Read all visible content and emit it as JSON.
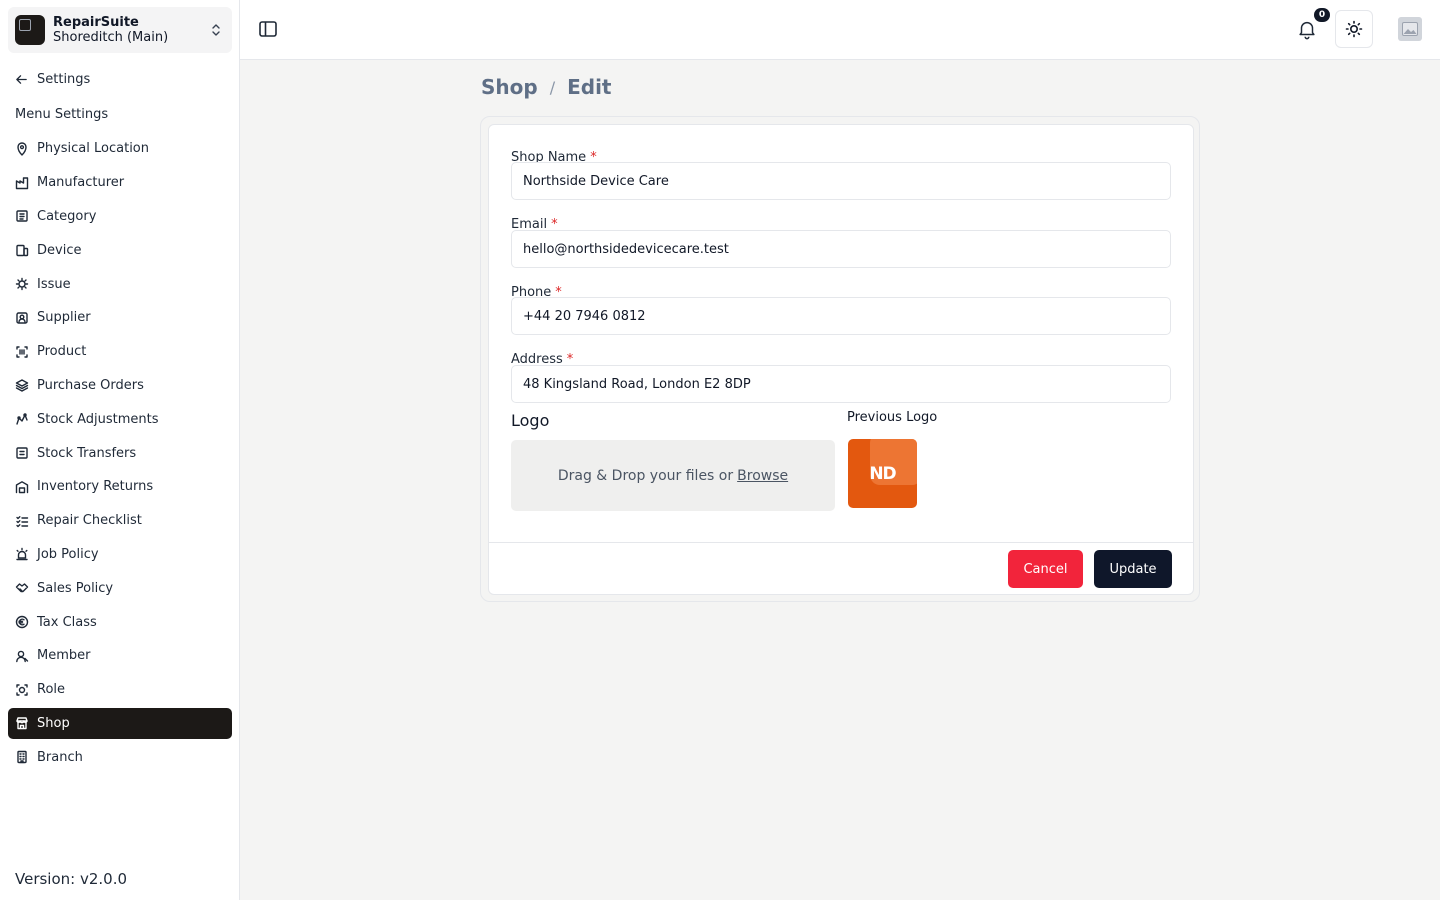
{
  "brand": {
    "name": "RepairSuite",
    "branch": "Shoreditch (Main)"
  },
  "back": {
    "label": "Settings"
  },
  "menu_heading": "Menu Settings",
  "nav": [
    {
      "label": "Physical Location",
      "icon": "location-icon",
      "active": false
    },
    {
      "label": "Manufacturer",
      "icon": "factory-icon",
      "active": false
    },
    {
      "label": "Category",
      "icon": "category-icon",
      "active": false
    },
    {
      "label": "Device",
      "icon": "device-icon",
      "active": false
    },
    {
      "label": "Issue",
      "icon": "issue-icon",
      "active": false
    },
    {
      "label": "Supplier",
      "icon": "supplier-icon",
      "active": false
    },
    {
      "label": "Product",
      "icon": "barcode-icon",
      "active": false
    },
    {
      "label": "Purchase Orders",
      "icon": "layers-icon",
      "active": false
    },
    {
      "label": "Stock Adjustments",
      "icon": "adjustments-icon",
      "active": false
    },
    {
      "label": "Stock Transfers",
      "icon": "transfer-icon",
      "active": false
    },
    {
      "label": "Inventory Returns",
      "icon": "warehouse-icon",
      "active": false
    },
    {
      "label": "Repair Checklist",
      "icon": "checklist-icon",
      "active": false
    },
    {
      "label": "Job Policy",
      "icon": "siren-icon",
      "active": false
    },
    {
      "label": "Sales Policy",
      "icon": "handshake-icon",
      "active": false
    },
    {
      "label": "Tax Class",
      "icon": "euro-icon",
      "active": false
    },
    {
      "label": "Member",
      "icon": "member-icon",
      "active": false
    },
    {
      "label": "Role",
      "icon": "role-icon",
      "active": false
    },
    {
      "label": "Shop",
      "icon": "store-icon",
      "active": true
    },
    {
      "label": "Branch",
      "icon": "building-icon",
      "active": false
    }
  ],
  "version": "Version: v2.0.0",
  "topbar": {
    "notification_count": "0"
  },
  "breadcrumb": {
    "section": "Shop",
    "separator": "/",
    "current": "Edit"
  },
  "form": {
    "shop_name": {
      "label": "Shop Name",
      "required": "*",
      "value": "Northside Device Care"
    },
    "email": {
      "label": "Email",
      "required": "*",
      "value": "hello@northsidedevicecare.test"
    },
    "phone": {
      "label": "Phone",
      "required": "*",
      "value": "+44 20 7946 0812"
    },
    "address": {
      "label": "Address",
      "required": "*",
      "value": "48 Kingsland Road, London E2 8DP"
    },
    "logo": {
      "label": "Logo",
      "drop_text": "Drag & Drop your files or",
      "browse": "Browse"
    },
    "previous_logo": {
      "label": "Previous Logo",
      "initials": "ND",
      "color": "#e3580f"
    }
  },
  "actions": {
    "cancel": "Cancel",
    "update": "Update"
  },
  "colors": {
    "active_nav": "#1c1917",
    "cancel": "#f2243b",
    "update": "#0f172a"
  }
}
